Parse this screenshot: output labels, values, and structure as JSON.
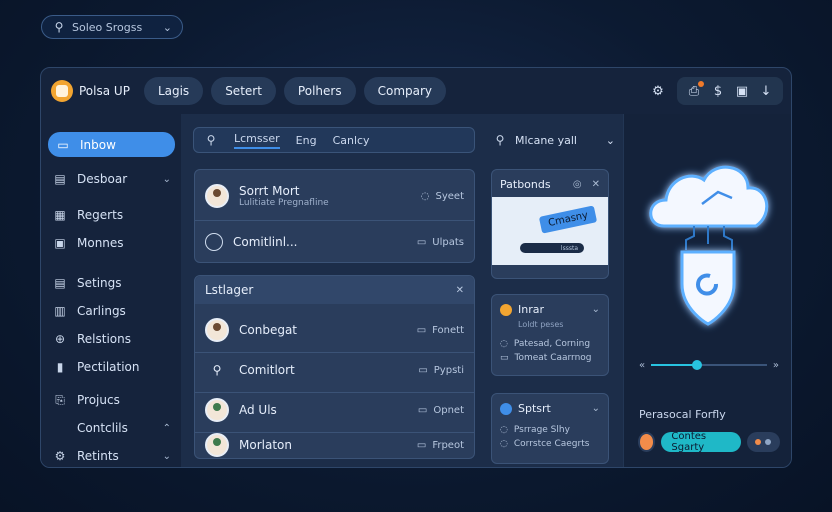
{
  "top_search": {
    "label": "Soleo Srogss"
  },
  "app": {
    "title": "Polsa UP",
    "tabs": [
      "Lagis",
      "Setert",
      "Polhers",
      "Compary"
    ]
  },
  "sidebar": {
    "items": [
      {
        "label": "Inbow",
        "active": true,
        "icon": "inbox-icon"
      },
      {
        "label": "Desboar",
        "icon": "dashboard-icon",
        "expandable": true
      },
      {
        "label": "Regerts",
        "icon": "reports-icon"
      },
      {
        "label": "Monnes",
        "icon": "monitor-icon"
      },
      {
        "label": "Setings",
        "icon": "settings-icon"
      },
      {
        "label": "Carlings",
        "icon": "cards-icon"
      },
      {
        "label": "Relstions",
        "icon": "relations-icon"
      },
      {
        "label": "Pectilation",
        "icon": "document-icon"
      },
      {
        "label": "Projucs",
        "icon": "projects-icon"
      },
      {
        "label": "Contclils",
        "icon": "",
        "expandable": true
      },
      {
        "label": "Retints",
        "icon": "settings-gear-icon",
        "expandable": true
      }
    ]
  },
  "content": {
    "search": {
      "seg1": "Lcmsser",
      "seg2": "Eng",
      "seg3": "Canlcy"
    },
    "right_search": {
      "label": "Mlcane yall"
    },
    "card1": {
      "rows": [
        {
          "title": "Sorrt Mort",
          "subtitle": "Lulitiate Pregnafline",
          "meta": "Syeet"
        },
        {
          "title": "Comitlinl...",
          "meta": "Ulpats"
        }
      ]
    },
    "card2": {
      "title": "Lstlager",
      "rows": [
        {
          "title": "Conbegat",
          "meta": "Fonett"
        },
        {
          "title": "Comitlort",
          "meta": "Pypsti"
        },
        {
          "title": "Ad Uls",
          "meta": "Opnet"
        },
        {
          "title": "Morlaton",
          "meta": "Frpeot"
        }
      ]
    },
    "mini1": {
      "title": "Patbonds",
      "tag": "Cmasny",
      "bar": "lsssta"
    },
    "mini2": {
      "title": "Inrar",
      "sub": "Loldt peses",
      "lines": [
        "Patesad, Corning",
        "Tomeat Caarrnog"
      ]
    },
    "mini3": {
      "title": "Sptsrt",
      "lines": [
        "Psrrage Slhy",
        "Corrstce Caegrts"
      ]
    }
  },
  "right_panel": {
    "slider": {
      "left": "«",
      "right": "»",
      "level": 0.4
    },
    "label": "Perasocal Forfly",
    "button": "Contes Sgarty"
  },
  "colors": {
    "accent": "#3f8ee8",
    "teal": "#1fb8c7",
    "orange": "#f2a531"
  }
}
